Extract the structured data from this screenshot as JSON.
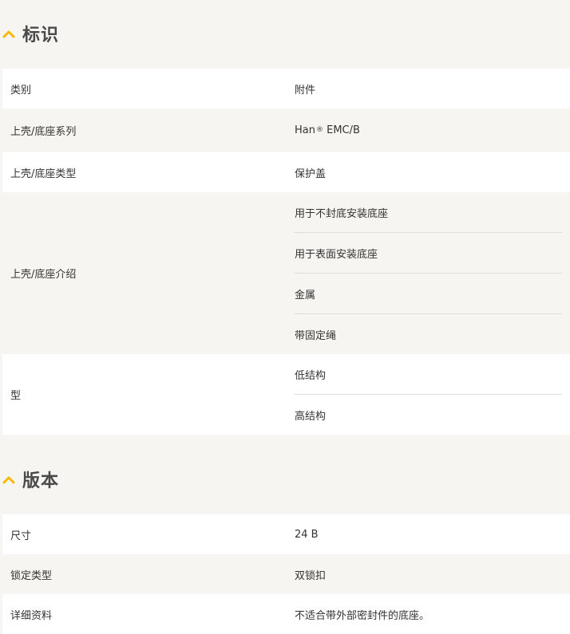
{
  "sections": [
    {
      "title": "标识",
      "rows": [
        {
          "label": "类别",
          "values": [
            "附件"
          ]
        },
        {
          "label": "上壳/底座系列",
          "values": [
            {
              "text": "Han",
              "sup": "®",
              "rest": " EMC/B"
            }
          ]
        },
        {
          "label": "上壳/底座类型",
          "values": [
            "保护盖"
          ]
        },
        {
          "label": "上壳/底座介绍",
          "values": [
            "用于不封底安装底座",
            "用于表面安装底座",
            "金属",
            "带固定绳"
          ]
        },
        {
          "label": "型",
          "values": [
            "低结构",
            "高结构"
          ]
        }
      ]
    },
    {
      "title": "版本",
      "rows": [
        {
          "label": "尺寸",
          "values": [
            "24 B"
          ]
        },
        {
          "label": "锁定类型",
          "values": [
            "双锁扣"
          ]
        },
        {
          "label": "详细资料",
          "values": [
            "不适合带外部密封件的底座。"
          ]
        }
      ]
    }
  ],
  "colors": {
    "accent": "#f5b800",
    "background": "#f6f5f2",
    "row_white": "#ffffff"
  },
  "icons": {
    "section_toggle": "chevron-up-icon"
  }
}
